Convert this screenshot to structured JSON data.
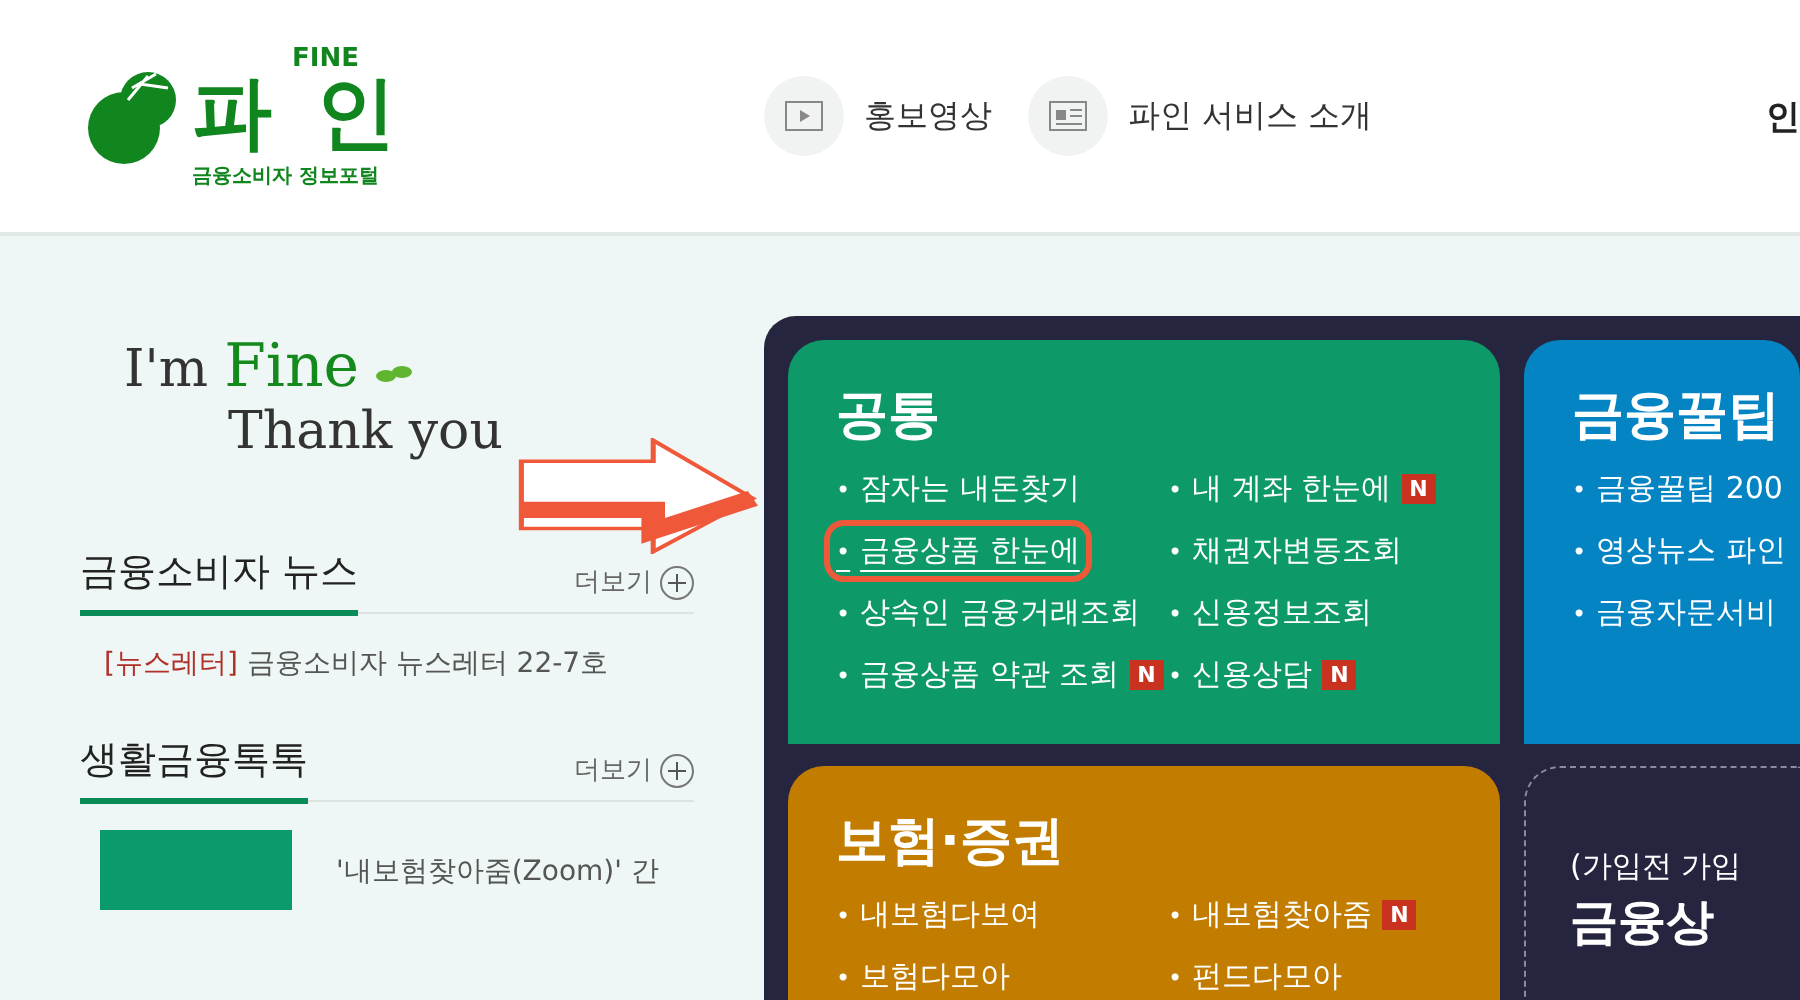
{
  "header": {
    "logo": {
      "top": "FINE",
      "name": "파 인",
      "sub": "금융소비자 정보포털"
    },
    "nav": [
      {
        "kind": "video",
        "label": "홍보영상"
      },
      {
        "kind": "card",
        "label": "파인 서비스 소개"
      }
    ],
    "cut_item": "인"
  },
  "slogan": {
    "lead": "I'm",
    "accent": "Fine",
    "line2": "Thank you"
  },
  "sections": [
    {
      "kind": "list",
      "title": "금융소비자 뉴스",
      "more": "더보기",
      "items": [
        {
          "tag": "[뉴스레터]",
          "text": "금융소비자 뉴스레터 22-7호"
        }
      ]
    },
    {
      "kind": "thumb",
      "title": "생활금융톡톡",
      "more": "더보기",
      "items": [
        {
          "text": "'내보험찾아줌(Zoom)' 간"
        }
      ]
    }
  ],
  "cards": [
    {
      "kind": "links",
      "title": "공통",
      "color": "#0e9a68",
      "bullet": "•",
      "links": [
        {
          "label": "잠자는 내돈찾기",
          "highlighted": false
        },
        {
          "label": "내 계좌 한눈에",
          "badge": "N",
          "highlighted": false
        },
        {
          "label": "금융상품 한눈에",
          "highlighted": true
        },
        {
          "label": "채권자변동조회",
          "highlighted": false
        },
        {
          "label": "상속인 금융거래조회",
          "highlighted": false
        },
        {
          "label": "신용정보조회",
          "highlighted": false
        },
        {
          "label": "금융상품 약관 조회",
          "badge": "N",
          "highlighted": false
        },
        {
          "label": "신용상담",
          "badge": "N",
          "highlighted": false
        }
      ]
    },
    {
      "kind": "links",
      "title": "금융꿀팁",
      "color": "#0584c4",
      "bullet": "•",
      "links": [
        {
          "label": "금융꿀팁 200",
          "highlighted": false
        },
        {
          "label": "영상뉴스 파인",
          "highlighted": false
        },
        {
          "label": "금융자문서비",
          "highlighted": false
        }
      ]
    },
    {
      "kind": "links",
      "title": "보험·증권",
      "color": "#c27d00",
      "bullet": "•",
      "links": [
        {
          "label": "내보험다보여",
          "highlighted": false
        },
        {
          "label": "내보험찾아줌",
          "badge": "N",
          "highlighted": false
        },
        {
          "label": "보험다모아",
          "highlighted": false
        },
        {
          "label": "펀드다모아",
          "highlighted": false
        }
      ]
    },
    {
      "kind": "promo",
      "subtitle": "(가입전 가입",
      "title": "금융상"
    }
  ]
}
